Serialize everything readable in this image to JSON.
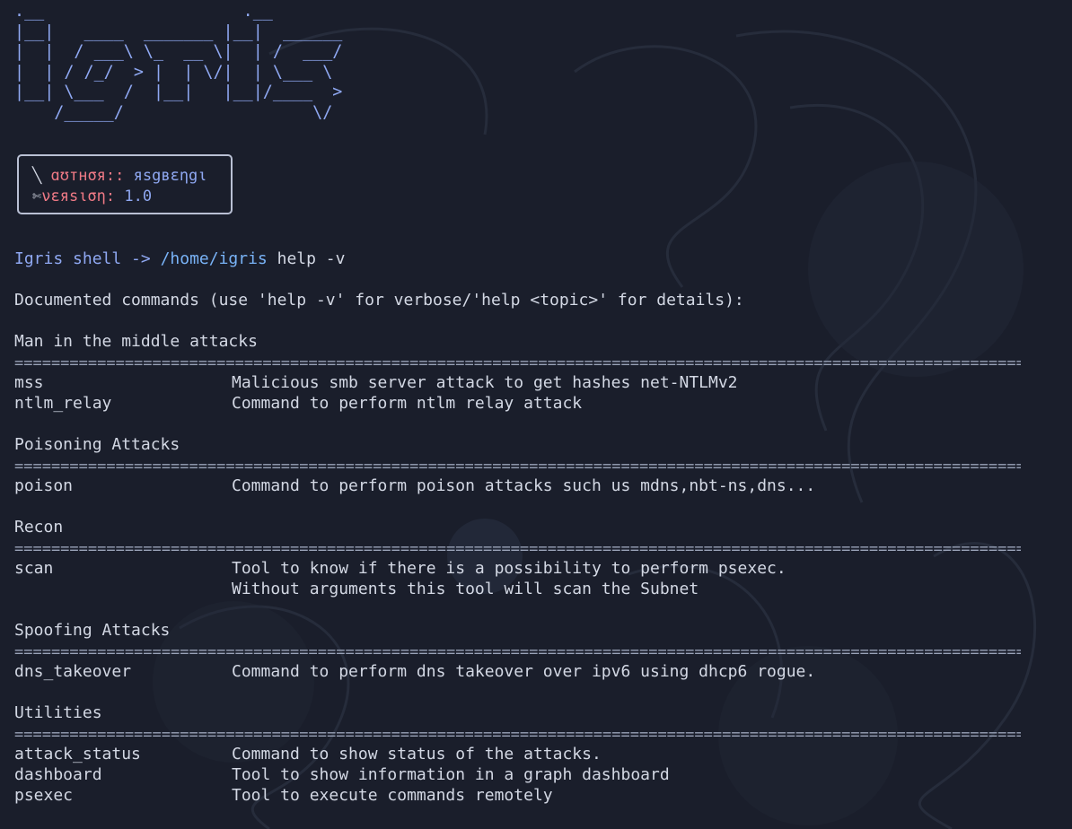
{
  "ascii_logo": {
    "lines": [
      ".__                    .__",
      "|__|   ____  _______ |__|  ______",
      "|  |  / ___\\ \\_  __ \\|  | /  ___/",
      "|  | / /_/  > |  | \\/|  | \\___ \\",
      "|__| \\___  /  |__|   |__|/____  >",
      "    /_____/                   \\/"
    ]
  },
  "info_box": {
    "author_icon": "╲",
    "author_key": "ɑʊтнσя::",
    "author_value": "яѕgвεηgι",
    "version_icon": "✄",
    "version_key": "νεяѕιση:",
    "version_value": "1.0"
  },
  "prompt": {
    "shell_name": "Igris shell -> ",
    "path": "/home/igris",
    "command": " help -v"
  },
  "documented_header": "Documented commands (use 'help -v' for verbose/'help <topic>' for details):",
  "separator": "==============================================================================================================================",
  "categories": [
    {
      "title": "Man in the middle attacks",
      "commands": [
        {
          "name": "mss",
          "desc": [
            "Malicious smb server attack to get hashes net-NTLMv2"
          ]
        },
        {
          "name": "ntlm_relay",
          "desc": [
            "Command to perform ntlm relay attack"
          ]
        }
      ]
    },
    {
      "title": "Poisoning Attacks",
      "commands": [
        {
          "name": "poison",
          "desc": [
            "Command to perform poison attacks such us mdns,nbt-ns,dns..."
          ]
        }
      ]
    },
    {
      "title": "Recon",
      "commands": [
        {
          "name": "scan",
          "desc": [
            "Tool to know if there is a possibility to perform psexec.",
            "Without arguments this tool will scan the Subnet"
          ]
        }
      ]
    },
    {
      "title": "Spoofing Attacks",
      "commands": [
        {
          "name": "dns_takeover",
          "desc": [
            "Command to perform dns takeover over ipv6 using dhcp6 rogue."
          ]
        }
      ]
    },
    {
      "title": "Utilities",
      "commands": [
        {
          "name": "attack_status",
          "desc": [
            "Command to show status of the attacks."
          ]
        },
        {
          "name": "dashboard",
          "desc": [
            "Tool to show information in a graph dashboard"
          ]
        },
        {
          "name": "psexec",
          "desc": [
            "Tool to execute commands remotely"
          ]
        }
      ]
    }
  ],
  "colors": {
    "background": "#1a1e2b",
    "text": "#d3d8e4",
    "logo": "#8fa8f2",
    "key_accent": "#f07a86",
    "path_accent": "#79b3f7"
  }
}
